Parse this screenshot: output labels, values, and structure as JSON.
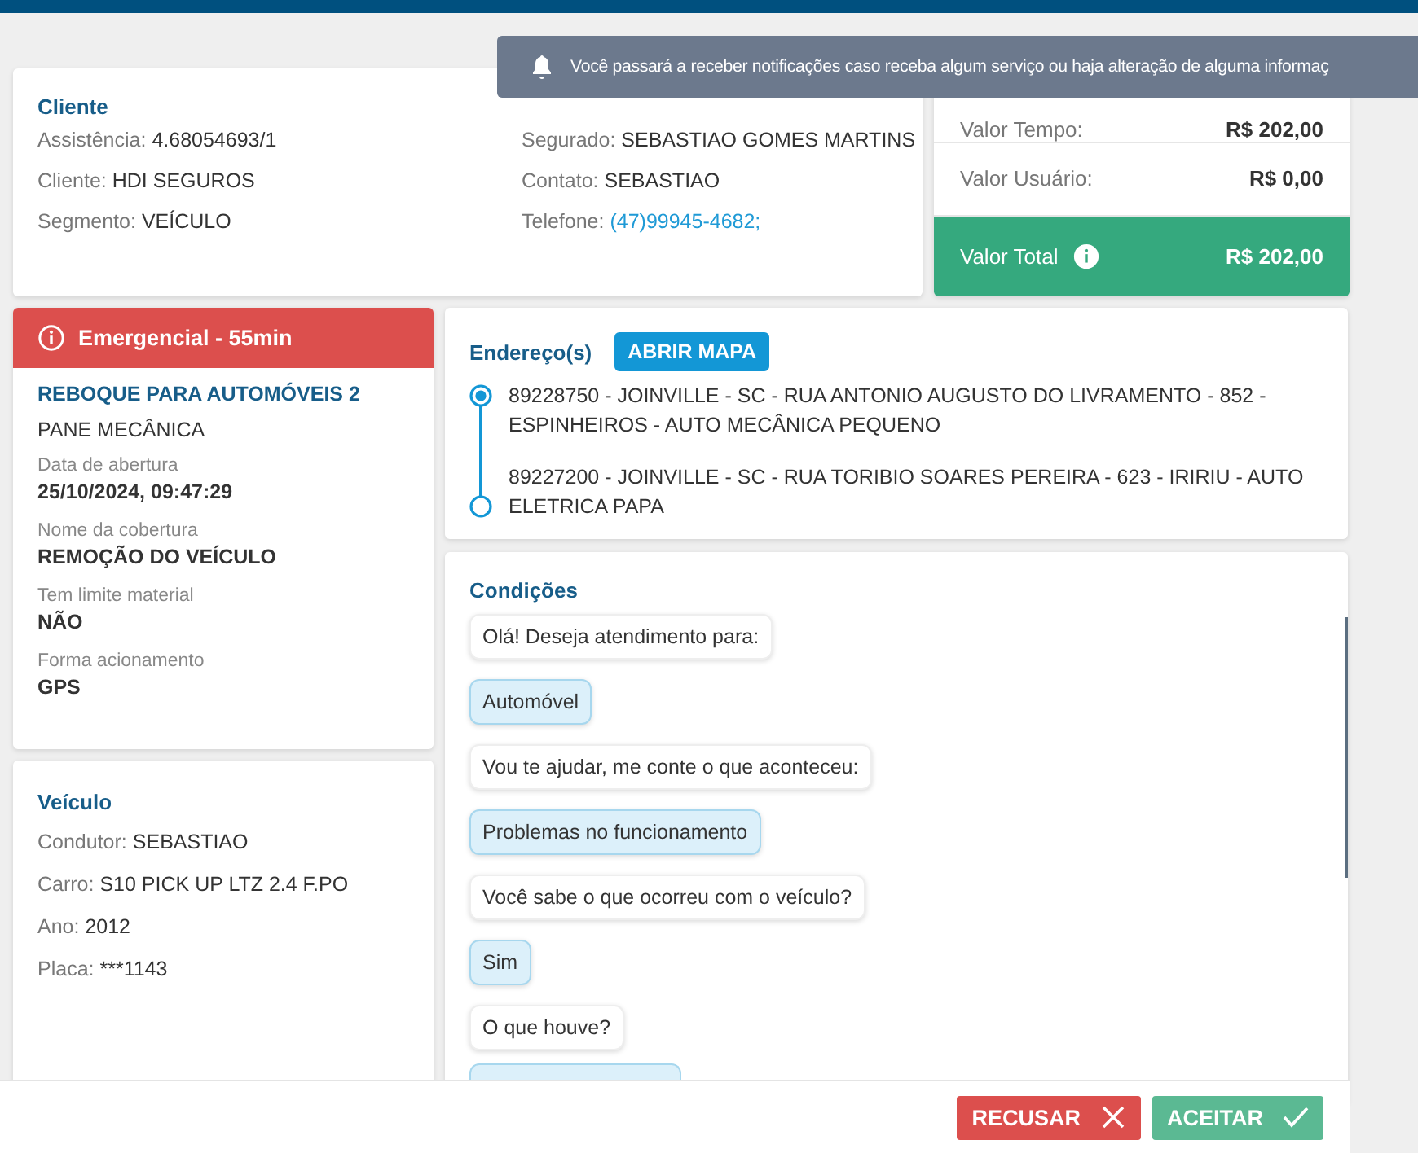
{
  "notification": {
    "text": "Você passará a receber notificações caso receba algum serviço ou haja alteração de alguma informaç"
  },
  "client": {
    "title": "Cliente",
    "columns": [
      [
        {
          "label": "Assistência:",
          "value": "4.68054693/1",
          "kind": "text"
        },
        {
          "label": "Cliente:",
          "value": "HDI SEGUROS",
          "kind": "text"
        },
        {
          "label": "Segmento:",
          "value": "VEÍCULO",
          "kind": "text"
        }
      ],
      [
        {
          "label": "Segurado:",
          "value": "SEBASTIAO GOMES MARTINS",
          "kind": "text"
        },
        {
          "label": "Contato:",
          "value": "SEBASTIAO",
          "kind": "text"
        },
        {
          "label": "Telefone:",
          "value": "(47)99945-4682;",
          "kind": "link"
        }
      ]
    ]
  },
  "values": {
    "rows": [
      {
        "label": "Valor Tempo:",
        "value": "R$ 202,00",
        "kind": "plain"
      },
      {
        "label": "Valor Usuário:",
        "value": "R$ 0,00",
        "kind": "plain"
      },
      {
        "label": "Valor Total",
        "value": "R$ 202,00",
        "kind": "total"
      }
    ]
  },
  "service": {
    "priority": "Emergencial - 55min",
    "title": "REBOQUE PARA AUTOMÓVEIS 2",
    "subtitle": "PANE MECÂNICA",
    "details": [
      {
        "label": "Data de abertura",
        "value": "25/10/2024, 09:47:29"
      },
      {
        "label": "Nome da cobertura",
        "value": "REMOÇÃO DO VEÍCULO"
      },
      {
        "label": "Tem limite material",
        "value": "NÃO"
      },
      {
        "label": "Forma acionamento",
        "value": "GPS"
      }
    ]
  },
  "vehicle": {
    "title": "Veículo",
    "fields": [
      {
        "label": "Condutor:",
        "value": "SEBASTIAO"
      },
      {
        "label": "Carro:",
        "value": "S10 PICK UP LTZ 2.4 F.PO"
      },
      {
        "label": "Ano:",
        "value": "2012"
      },
      {
        "label": "Placa:",
        "value": "***1143"
      }
    ]
  },
  "addresses": {
    "title": "Endereço(s)",
    "map_button": "ABRIR MAPA",
    "stops": [
      {
        "text": "89228750 - JOINVILLE - SC - RUA ANTONIO AUGUSTO DO LIVRAMENTO - 852 - ESPINHEIROS - AUTO MECÂNICA PEQUENO",
        "selected": true
      },
      {
        "text": "89227200 - JOINVILLE - SC - RUA TORIBIO SOARES PEREIRA - 623 - IRIRIU - AUTO ELETRICA PAPA",
        "selected": false
      }
    ]
  },
  "conditions": {
    "title": "Condições",
    "messages": [
      {
        "text": "Olá! Deseja atendimento para:",
        "kind": "question"
      },
      {
        "text": "Automóvel",
        "kind": "answer"
      },
      {
        "text": "Vou te ajudar, me conte o que aconteceu:",
        "kind": "question"
      },
      {
        "text": "Problemas no funcionamento",
        "kind": "answer"
      },
      {
        "text": "Você sabe o que ocorreu com o veículo?",
        "kind": "question"
      },
      {
        "text": "Sim",
        "kind": "answer"
      },
      {
        "text": "O que houve?",
        "kind": "question"
      }
    ]
  },
  "actions": [
    {
      "label": "RECUSAR",
      "kind": "reject"
    },
    {
      "label": "ACEITAR",
      "kind": "accept"
    }
  ]
}
